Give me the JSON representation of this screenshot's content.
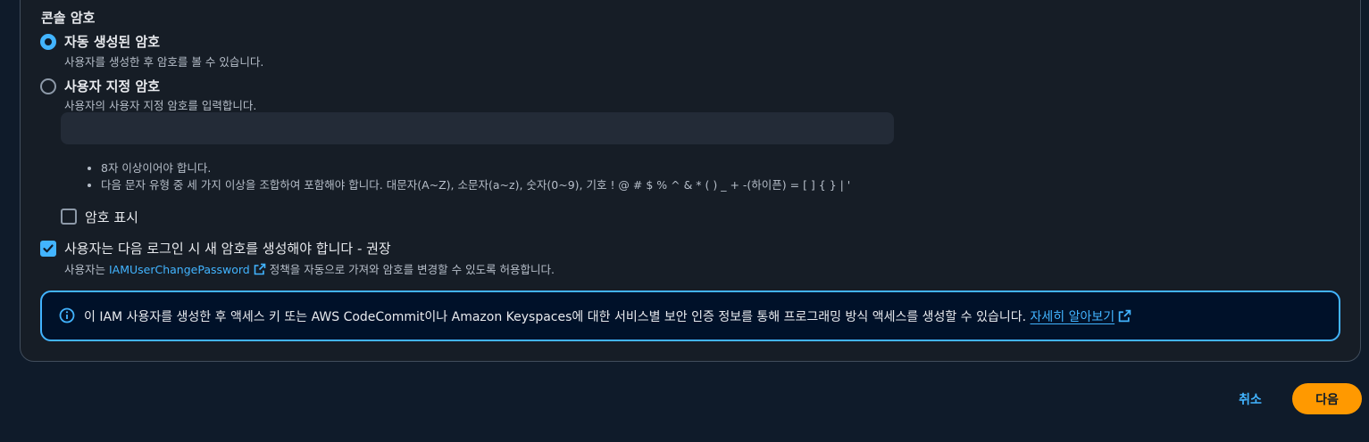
{
  "console_password": {
    "title": "콘솔 암호",
    "auto_option": {
      "label": "자동 생성된 암호",
      "description": "사용자를 생성한 후 암호를 볼 수 있습니다.",
      "selected": true
    },
    "custom_option": {
      "label": "사용자 지정 암호",
      "description": "사용자의 사용자 지정 암호를 입력합니다.",
      "selected": false,
      "input_value": "",
      "input_placeholder": ""
    },
    "rules": [
      "8자 이상이어야 합니다.",
      "다음 문자 유형 중 세 가지 이상을 조합하여 포함해야 합니다. 대문자(A~Z), 소문자(a~z), 숫자(0~9), 기호 ! @ # $ % ^ & * ( ) _ + -(하이픈) = [ ] { } | '"
    ],
    "show_password": {
      "label": "암호 표시",
      "checked": false
    },
    "require_reset": {
      "label": "사용자는 다음 로그인 시 새 암호를 생성해야 합니다 - 권장",
      "checked": true,
      "desc_prefix": "사용자는 ",
      "policy_link": "IAMUserChangePassword",
      "desc_suffix": " 정책을 자동으로 가져와 암호를 변경할 수 있도록 허용합니다."
    }
  },
  "info": {
    "icon": "info-icon",
    "text": "이 IAM 사용자를 생성한 후 액세스 키 또는 AWS CodeCommit이나 Amazon Keyspaces에 대한 서비스별 보안 인증 정보를 통해 프로그래밍 방식 액세스를 생성할 수 있습니다. ",
    "link": "자세히 알아보기"
  },
  "footer": {
    "cancel_label": "취소",
    "next_label": "다음"
  },
  "colors": {
    "background": "#0f1b2a",
    "panel": "#161d26",
    "accent": "#42b4ff",
    "primary_button": "#ff9900"
  }
}
